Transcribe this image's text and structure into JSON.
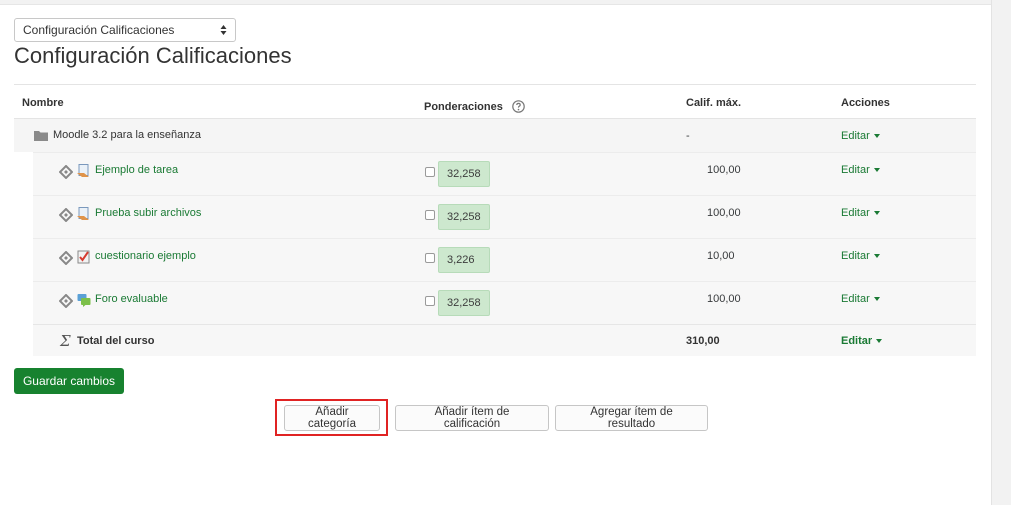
{
  "view_selector": {
    "selected": "Configuración Calificaciones"
  },
  "page": {
    "title": "Configuración Calificaciones"
  },
  "table": {
    "headers": {
      "name": "Nombre",
      "weights": "Ponderaciones",
      "max_grade": "Calif. máx.",
      "actions": "Acciones"
    },
    "category": {
      "name": "Moodle 3.2 para la enseñanza",
      "max_grade": "-",
      "action": "Editar",
      "icon": "folder-icon"
    },
    "items": [
      {
        "name": "Ejemplo de tarea",
        "weight": "32,258",
        "max_grade": "100,00",
        "action": "Editar",
        "icon": "assignment-icon"
      },
      {
        "name": "Prueba subir archivos",
        "weight": "32,258",
        "max_grade": "100,00",
        "action": "Editar",
        "icon": "assignment-icon"
      },
      {
        "name": "cuestionario ejemplo",
        "weight": "3,226",
        "max_grade": "10,00",
        "action": "Editar",
        "icon": "quiz-icon"
      },
      {
        "name": "Foro evaluable",
        "weight": "32,258",
        "max_grade": "100,00",
        "action": "Editar",
        "icon": "forum-icon"
      }
    ],
    "total": {
      "name": "Total del curso",
      "max_grade": "310,00",
      "action": "Editar",
      "icon": "sigma-icon"
    }
  },
  "buttons": {
    "save": "Guardar cambios",
    "add_category": "Añadir categoría",
    "add_grade_item": "Añadir ítem de calificación",
    "add_outcome_item": "Agregar ítem de resultado"
  },
  "colors": {
    "accent_green": "#17822f",
    "link_green": "#1a7a34",
    "weight_bg": "#cde8ce",
    "highlight": "#e02323"
  }
}
